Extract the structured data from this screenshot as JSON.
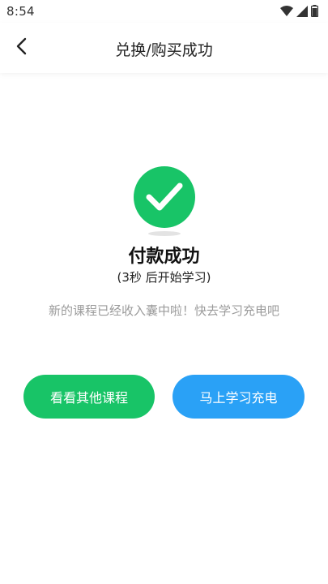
{
  "status_bar": {
    "time": "8:54",
    "icons": [
      "wifi-icon",
      "signal-icon",
      "battery-icon"
    ]
  },
  "nav": {
    "back_icon": "chevron-left-icon",
    "title": "兑换/购买成功"
  },
  "result": {
    "icon": "check-circle-icon",
    "title": "付款成功",
    "countdown": "(3秒 后开始学习)",
    "message": "新的课程已经收入囊中啦！快去学习充电吧"
  },
  "actions": {
    "browse_label": "看看其他课程",
    "study_label": "马上学习充电"
  },
  "colors": {
    "success_green": "#18c467",
    "action_blue": "#2aa1f6",
    "muted_text": "#9b9b9b"
  }
}
